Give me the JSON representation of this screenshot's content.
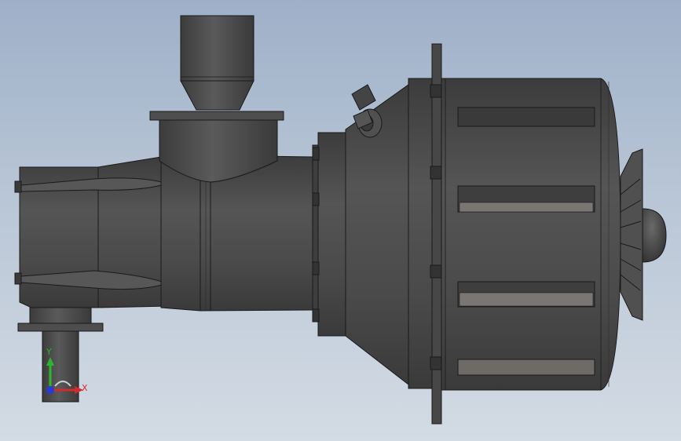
{
  "viewport": {
    "background_top": "#9eb0c8",
    "background_bottom": "#d3dbe4"
  },
  "model": {
    "body_color": "#4a4a4a",
    "edge_color": "#1a1a1a",
    "highlight_color": "#6a6a6a",
    "slot_color": "#7a7773"
  },
  "triad": {
    "y_label": "Y",
    "x_label": "X",
    "y_color": "#2db52d",
    "x_color": "#d42a2a",
    "z_color": "#2a3ad4"
  }
}
